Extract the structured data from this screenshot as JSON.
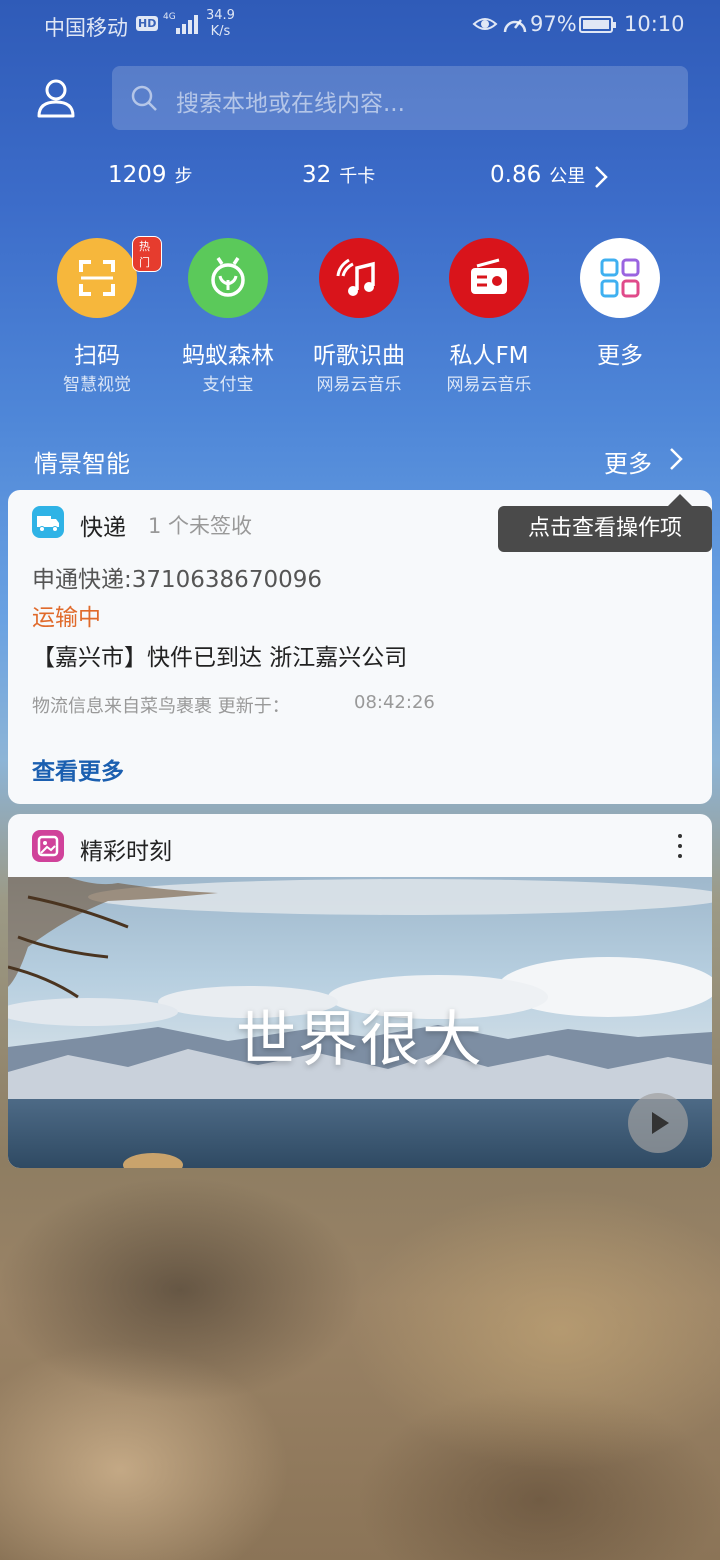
{
  "status_bar": {
    "carrier": "中国移动",
    "hd": "HD",
    "network": "4G",
    "speed_value": "34.9",
    "speed_unit": "K/s",
    "battery": "97%",
    "time": "10:10"
  },
  "search": {
    "placeholder": "搜索本地或在线内容..."
  },
  "stats": [
    {
      "value": "1209",
      "unit": "步"
    },
    {
      "value": "32",
      "unit": "千卡"
    },
    {
      "value": "0.86",
      "unit": "公里"
    }
  ],
  "apps": [
    {
      "name": "扫码",
      "sub": "智慧视觉",
      "badge": "热门",
      "color": "#f6b73c",
      "icon": "scan-icon"
    },
    {
      "name": "蚂蚁森林",
      "sub": "支付宝",
      "color": "#5bc95a",
      "icon": "sprout-icon"
    },
    {
      "name": "听歌识曲",
      "sub": "网易云音乐",
      "color": "#d9141b",
      "icon": "music-note-icon"
    },
    {
      "name": "私人FM",
      "sub": "网易云音乐",
      "color": "#d9141b",
      "icon": "radio-icon"
    },
    {
      "name": "更多",
      "sub": "",
      "color": "#ffffff",
      "icon": "grid-icon"
    }
  ],
  "section": {
    "title": "情景智能",
    "more": "更多"
  },
  "tooltip": "点击查看操作项",
  "express_card": {
    "title": "快递",
    "subtitle": "1 个未签收",
    "tracking": "申通快递:3710638670096",
    "status": "运输中",
    "message": "【嘉兴市】快件已到达 浙江嘉兴公司",
    "info": "物流信息来自菜鸟裹裹 更新于：",
    "time": "08:42:26",
    "more": "查看更多"
  },
  "moments_card": {
    "title": "精彩时刻",
    "caption": "世界很大"
  }
}
